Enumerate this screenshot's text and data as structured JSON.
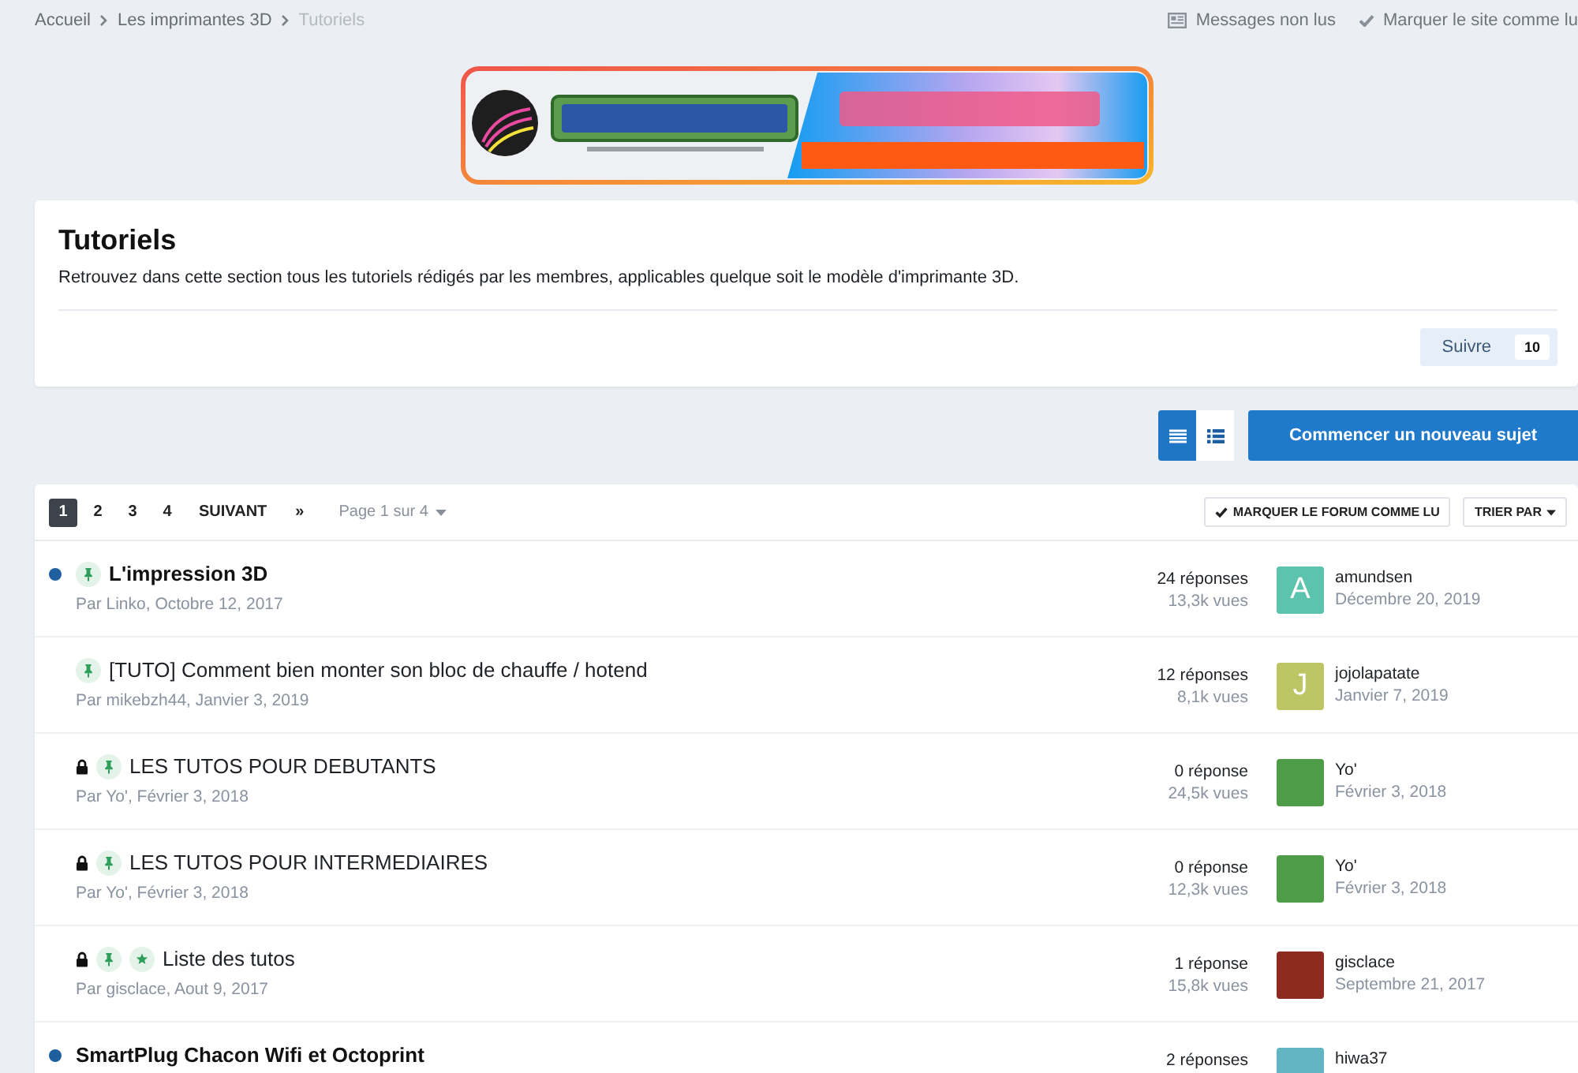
{
  "breadcrumb": [
    {
      "label": "Accueil",
      "current": false
    },
    {
      "label": "Les imprimantes 3D",
      "current": false
    },
    {
      "label": "Tutoriels",
      "current": true
    }
  ],
  "top_links": [
    {
      "kind": "messages",
      "label": "Messages non lus"
    },
    {
      "kind": "mark_read",
      "label": "Marquer le site comme lu"
    }
  ],
  "forum_header": {
    "title": "Tutoriels",
    "description": "Retrouvez dans cette section tous les tutoriels rédigés par les membres, applicables quelque soit le modèle d'imprimante 3D.",
    "follow_button": {
      "label": "Suivre",
      "count": "10"
    }
  },
  "view_modes": [
    {
      "kind": "list",
      "selected": true
    },
    {
      "kind": "bulleted",
      "selected": false
    }
  ],
  "new_topic_button": "Commencer un nouveau sujet",
  "pagination": {
    "pages": [
      {
        "label": "1",
        "selected": true
      },
      {
        "label": "2",
        "selected": false
      },
      {
        "label": "3",
        "selected": false
      },
      {
        "label": "4",
        "selected": false
      }
    ],
    "next": "SUIVANT",
    "last": "»",
    "page_menu": "Page 1 sur 4"
  },
  "list_actions": {
    "mark_read": "MARQUER LE FORUM COMME LU",
    "sort": "TRIER PAR"
  },
  "topics": [
    {
      "title": "L'impression 3D",
      "meta": "Par Linko, Octobre 12, 2017",
      "unread": true,
      "locked": false,
      "pinned": true,
      "featured": false,
      "replies": "24 réponses",
      "views": "13,3k vues",
      "last_poster": {
        "name": "amundsen",
        "date": "Décembre 20, 2019",
        "avatar": {
          "kind": "letter",
          "letter": "A",
          "color": "#5cc3ad"
        }
      }
    },
    {
      "title": "[TUTO] Comment bien monter son bloc de chauffe / hotend",
      "meta": "Par mikebzh44, Janvier 3, 2019",
      "unread": false,
      "locked": false,
      "pinned": true,
      "featured": false,
      "replies": "12 réponses",
      "views": "8,1k vues",
      "last_poster": {
        "name": "jojolapatate",
        "date": "Janvier 7, 2019",
        "avatar": {
          "kind": "letter",
          "letter": "J",
          "color": "#bdc565"
        }
      }
    },
    {
      "title": "LES TUTOS POUR DEBUTANTS",
      "meta": "Par Yo', Février 3, 2018",
      "unread": false,
      "locked": true,
      "pinned": true,
      "featured": false,
      "replies": "0 réponse",
      "views": "24,5k vues",
      "last_poster": {
        "name": "Yo'",
        "date": "Février 3, 2018",
        "avatar": {
          "kind": "image",
          "color": "#4c9c48"
        }
      }
    },
    {
      "title": "LES TUTOS POUR INTERMEDIAIRES",
      "meta": "Par Yo', Février 3, 2018",
      "unread": false,
      "locked": true,
      "pinned": true,
      "featured": false,
      "replies": "0 réponse",
      "views": "12,3k vues",
      "last_poster": {
        "name": "Yo'",
        "date": "Février 3, 2018",
        "avatar": {
          "kind": "image",
          "color": "#4c9c48"
        }
      }
    },
    {
      "title": "Liste des tutos",
      "meta": "Par gisclace, Aout 9, 2017",
      "unread": false,
      "locked": true,
      "pinned": true,
      "featured": true,
      "replies": "1 réponse",
      "views": "15,8k vues",
      "last_poster": {
        "name": "gisclace",
        "date": "Septembre 21, 2017",
        "avatar": {
          "kind": "image",
          "color": "#8e2a20"
        }
      }
    },
    {
      "title": "SmartPlug Chacon Wifi et Octoprint",
      "unread": true,
      "locked": false,
      "pinned": false,
      "featured": false,
      "replies": "2 réponses",
      "last_poster": {
        "name": "hiwa37",
        "avatar": {
          "kind": "image",
          "color": "#62b6c4"
        }
      }
    }
  ]
}
